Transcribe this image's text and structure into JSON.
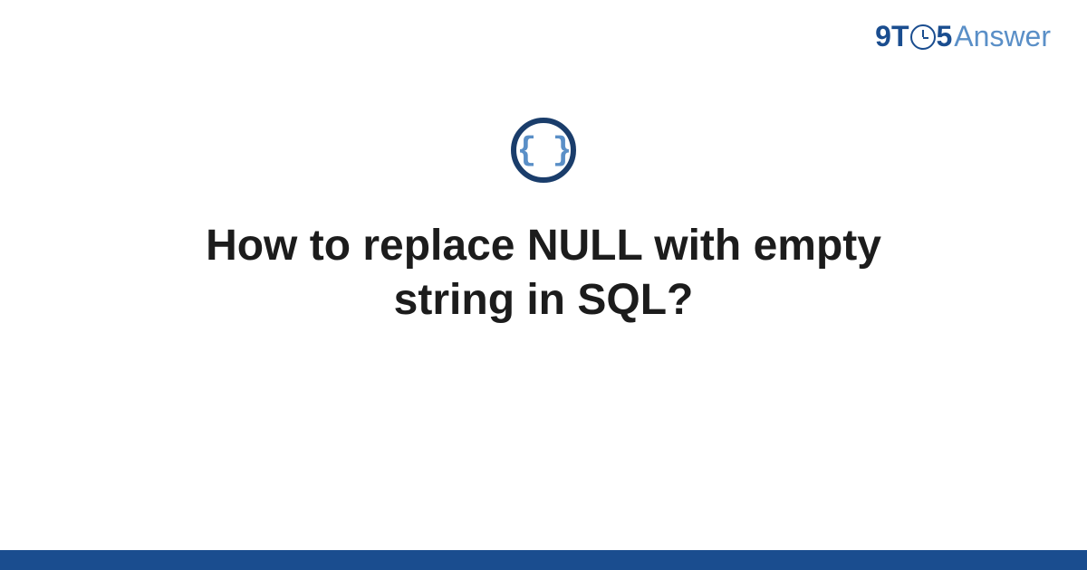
{
  "brand": {
    "part1": "9T",
    "part2": "5",
    "part3": "Answer"
  },
  "icon": {
    "braces": "{ }"
  },
  "title": "How to replace NULL with empty string in SQL?"
}
